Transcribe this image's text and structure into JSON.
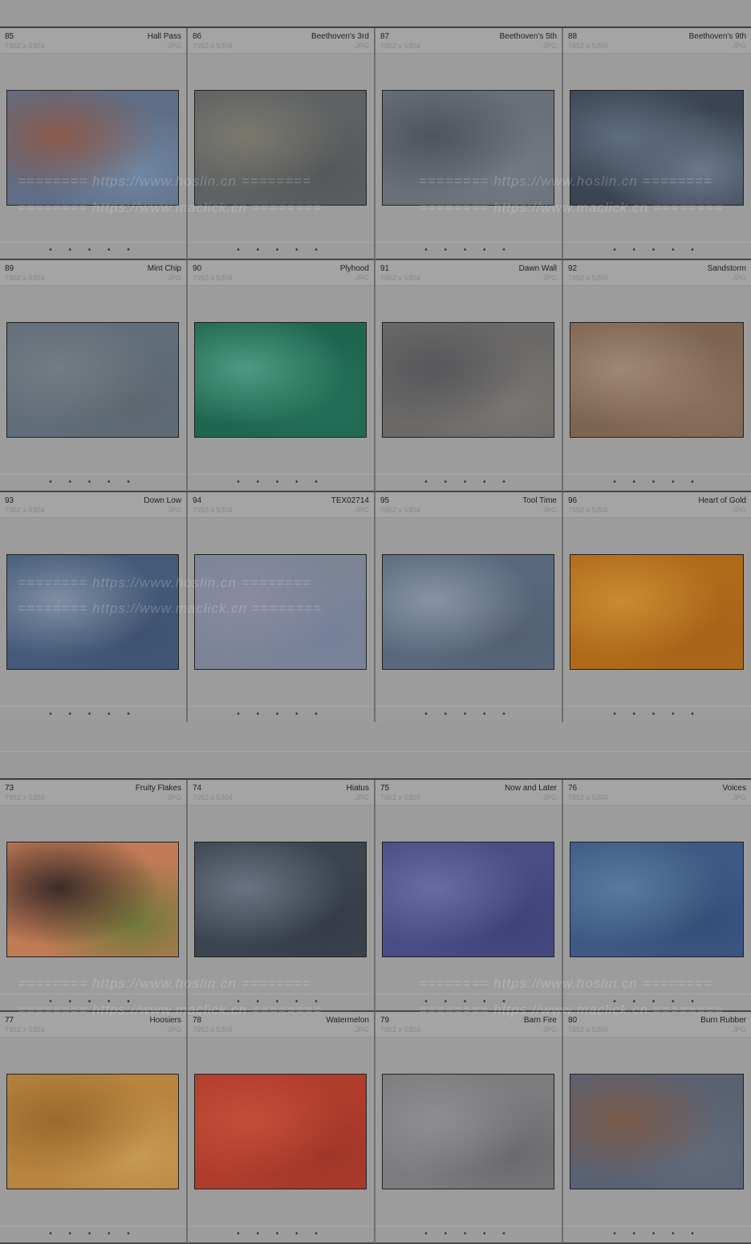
{
  "grid1": [
    {
      "num": "85",
      "title": "Hall Pass",
      "dims": "7952 x 5304",
      "type": "JPG",
      "colors": [
        "#5f6e86",
        "#8a5a4c",
        "#6f86a2"
      ]
    },
    {
      "num": "86",
      "title": "Beethoven's 3rd",
      "dims": "7952 x 5304",
      "type": "JPG",
      "colors": [
        "#5e6264",
        "#7b786e",
        "#55585a"
      ]
    },
    {
      "num": "87",
      "title": "Beethoven's 5th",
      "dims": "7952 x 5304",
      "type": "JPG",
      "colors": [
        "#6a7078",
        "#4f555d",
        "#727a84"
      ]
    },
    {
      "num": "88",
      "title": "Beethoven's 9th",
      "dims": "7952 x 5304",
      "type": "JPG",
      "colors": [
        "#3a4452",
        "#5f6e80",
        "#6c7a8c"
      ]
    },
    {
      "num": "89",
      "title": "Mint Chip",
      "dims": "7952 x 5304",
      "type": "JPG",
      "colors": [
        "#616d78",
        "#737c84",
        "#5c6770"
      ]
    },
    {
      "num": "90",
      "title": "Plyhood",
      "dims": "7952 x 5304",
      "type": "JPG",
      "colors": [
        "#1f6650",
        "#4e9a82",
        "#256f58"
      ]
    },
    {
      "num": "91",
      "title": "Dawn Wall",
      "dims": "7952 x 5304",
      "type": "JPG",
      "colors": [
        "#6c6a68",
        "#57585c",
        "#7a7672"
      ]
    },
    {
      "num": "92",
      "title": "Sandstorm",
      "dims": "7952 x 5304",
      "type": "JPG",
      "colors": [
        "#7e6552",
        "#a08774",
        "#8a705c"
      ]
    },
    {
      "num": "93",
      "title": "Down Low",
      "dims": "7952 x 5304",
      "type": "JPG",
      "colors": [
        "#445a78",
        "#7e8ea4",
        "#3e5270"
      ]
    },
    {
      "num": "94",
      "title": "TEX02714",
      "dims": "7952 x 5304",
      "type": "JPG",
      "colors": [
        "#7c8496",
        "#8a8aa0",
        "#75809a"
      ]
    },
    {
      "num": "95",
      "title": "Tool Time",
      "dims": "7952 x 5304",
      "type": "JPG",
      "colors": [
        "#59687c",
        "#8794a6",
        "#536074"
      ]
    },
    {
      "num": "96",
      "title": "Heart of Gold",
      "dims": "7952 x 5304",
      "type": "JPG",
      "colors": [
        "#b06a1a",
        "#c98a30",
        "#a8621a"
      ]
    }
  ],
  "grid2": [
    {
      "num": "73",
      "title": "Fruity Flakes",
      "dims": "7952 x 5304",
      "type": "JPG",
      "colors": [
        "#c07a55",
        "#3c2c28",
        "#6f7a3a"
      ]
    },
    {
      "num": "74",
      "title": "Hiatus",
      "dims": "7952 x 5304",
      "type": "JPG",
      "colors": [
        "#3c4450",
        "#6a7482",
        "#353c48"
      ]
    },
    {
      "num": "75",
      "title": "Now and Later",
      "dims": "7952 x 5304",
      "type": "JPG",
      "colors": [
        "#4a4c86",
        "#6a6aa4",
        "#3e4278"
      ]
    },
    {
      "num": "76",
      "title": "Voices",
      "dims": "7952 x 5304",
      "type": "JPG",
      "colors": [
        "#3e5a84",
        "#5a7aa0",
        "#344e78"
      ]
    },
    {
      "num": "77",
      "title": "Hoosiers",
      "dims": "7952 x 5304",
      "type": "JPG",
      "colors": [
        "#b8843e",
        "#9a6a2e",
        "#c89a52"
      ]
    },
    {
      "num": "78",
      "title": "Watermelon",
      "dims": "7952 x 5304",
      "type": "JPG",
      "colors": [
        "#b03c2c",
        "#c44e3a",
        "#a03628"
      ]
    },
    {
      "num": "79",
      "title": "Barn Fire",
      "dims": "7952 x 5304",
      "type": "JPG",
      "colors": [
        "#7c7c7e",
        "#8e8e90",
        "#6a6a6c"
      ]
    },
    {
      "num": "80",
      "title": "Burn Rubber",
      "dims": "7952 x 5304",
      "type": "JPG",
      "colors": [
        "#5a6272",
        "#7a5a4a",
        "#606a7a"
      ]
    }
  ],
  "dots": "• • • • •",
  "watermarks": {
    "hoslin": "======== https://www.hoslin.cn ========",
    "maclick": "======== https://www.maclick.cn ========"
  }
}
